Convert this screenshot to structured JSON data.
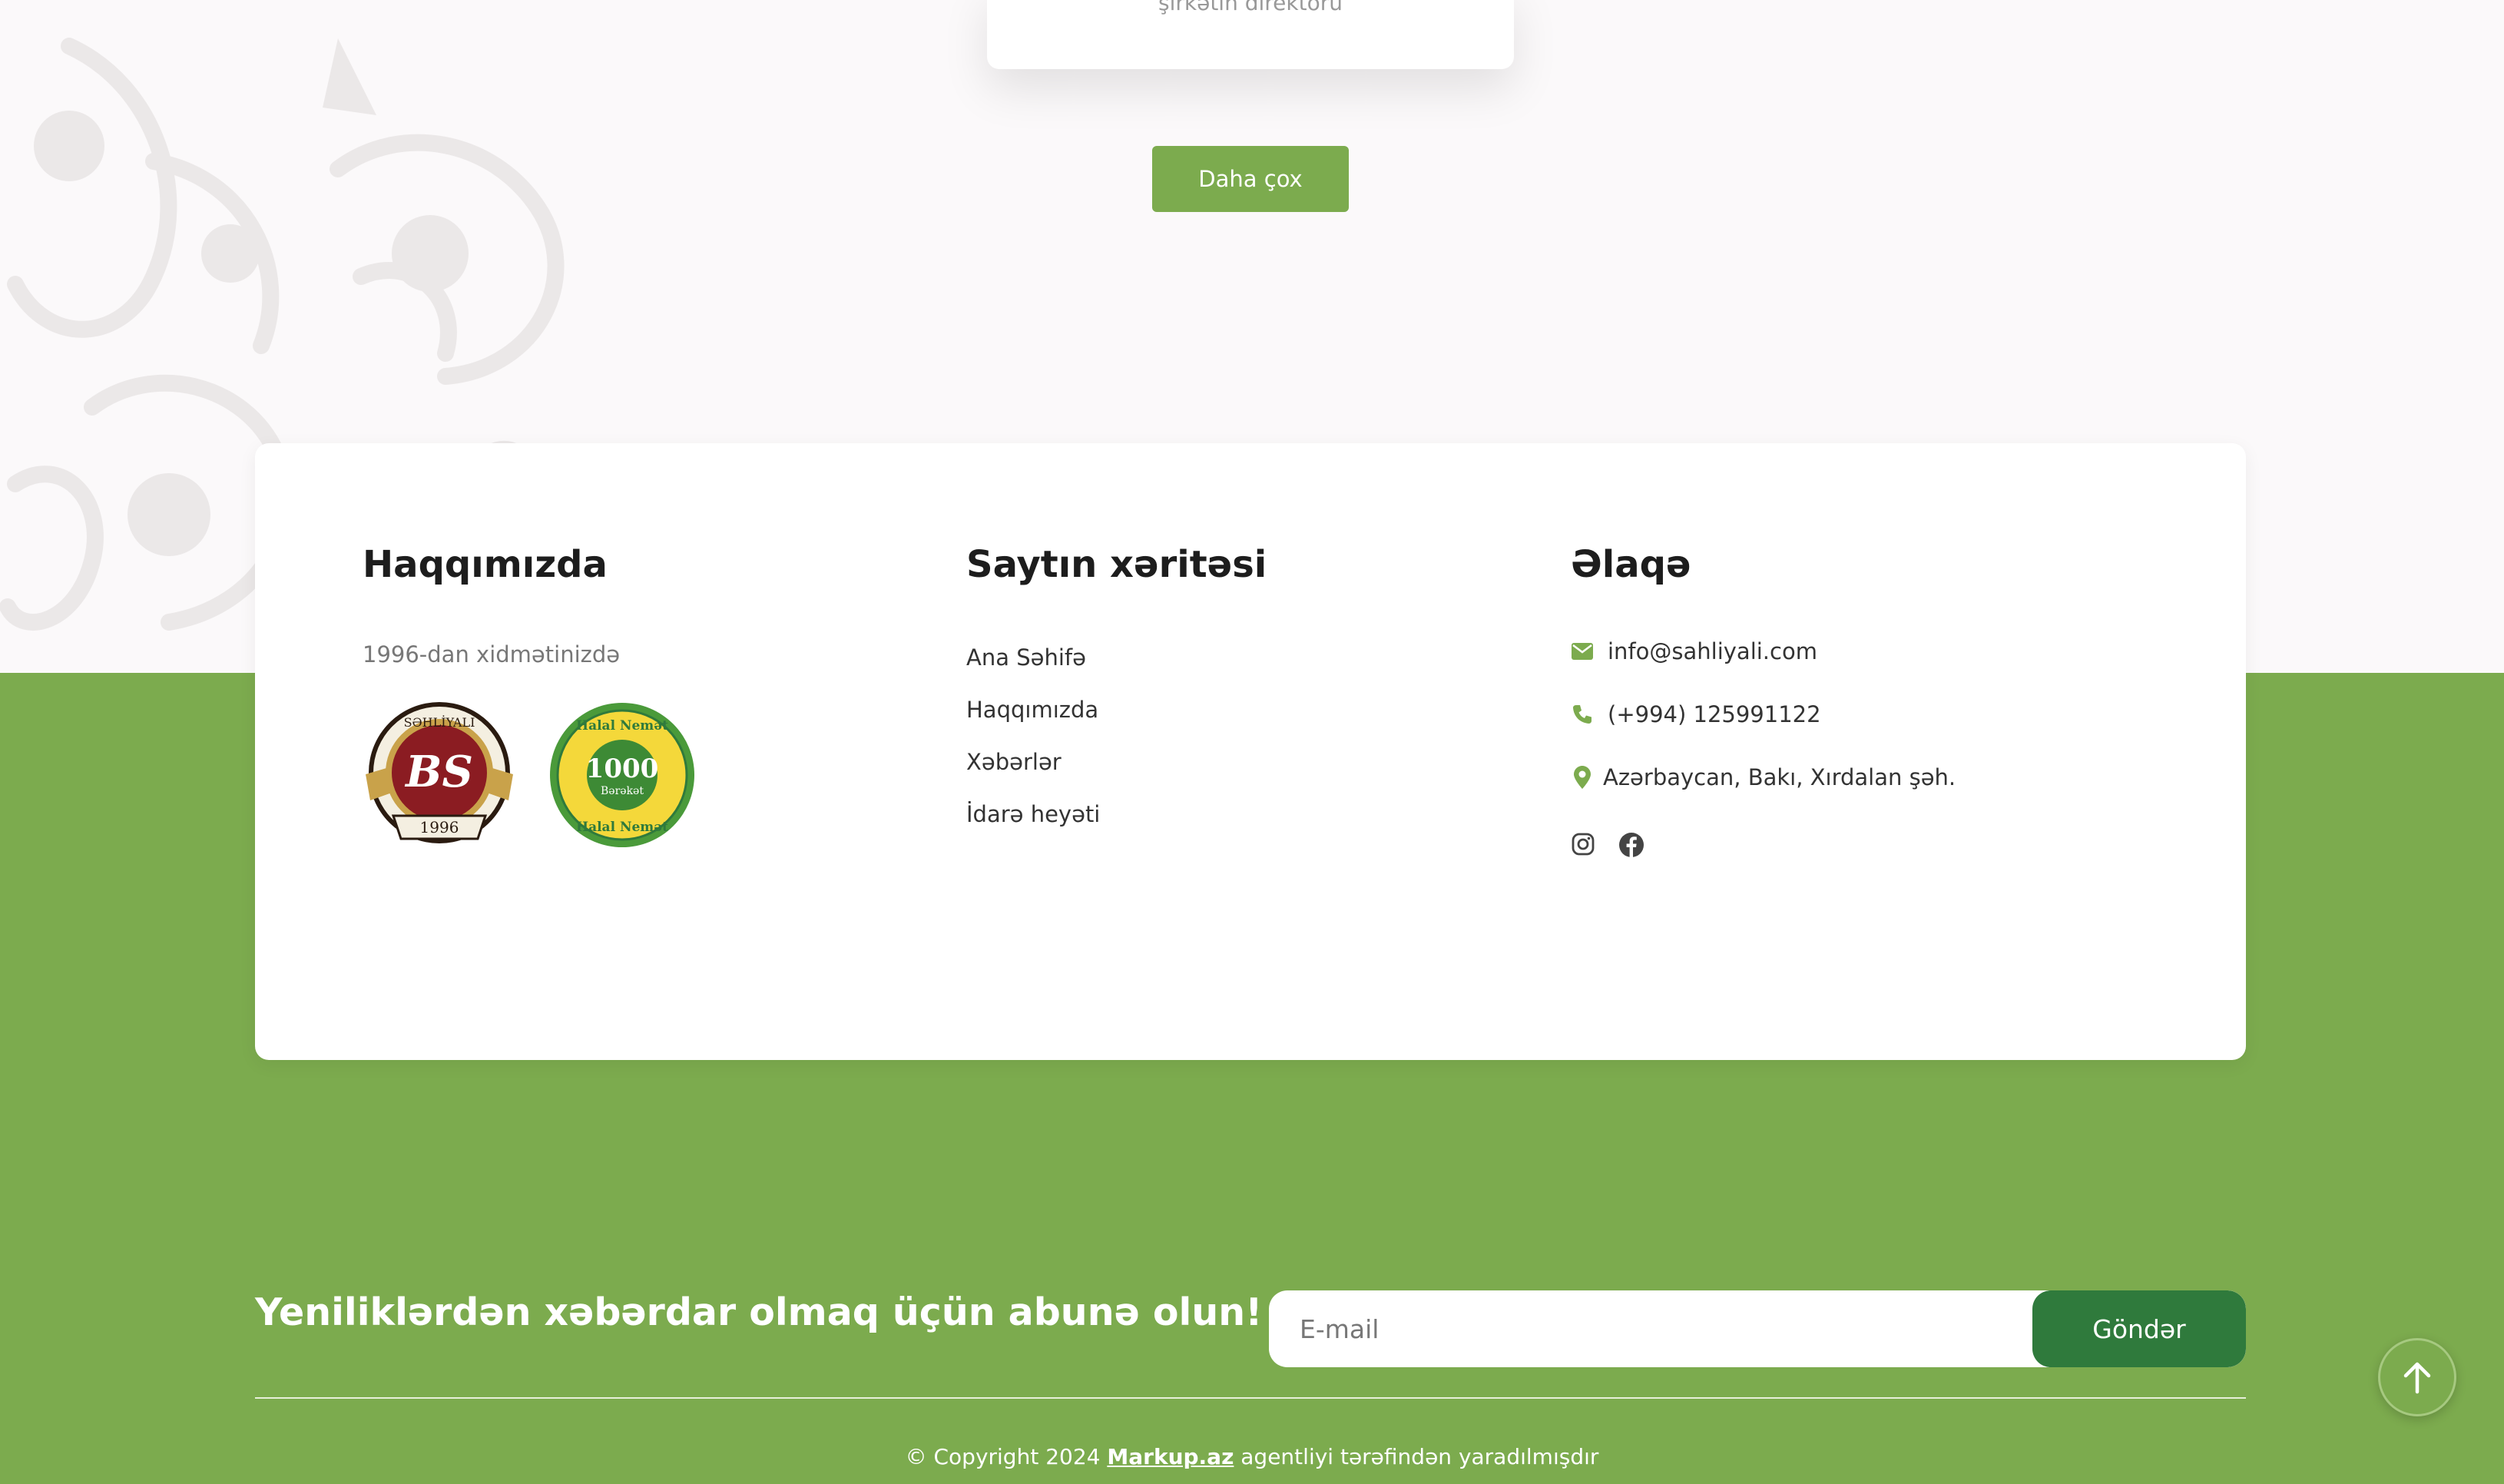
{
  "featured_card": {
    "clipped_text": "şirkətin direktoru"
  },
  "more_button": {
    "label": "Daha çox"
  },
  "footer": {
    "about": {
      "title": "Haqqımızda",
      "text": "1996-dan xidmətinizdə",
      "logos": [
        {
          "name": "sahliyali-logo",
          "text_top": "SƏHLİYALI",
          "monogram": "BS",
          "year": "1996"
        },
        {
          "name": "halal-nemat-logo",
          "text_top": "Halal Nemət",
          "center": "1000",
          "center_sub": "Bərəkət",
          "text_bottom": "Halal Nemət"
        }
      ]
    },
    "sitemap": {
      "title": "Saytın xəritəsi",
      "links": [
        "Ana Səhifə",
        "Haqqımızda",
        "Xəbərlər",
        "İdarə heyəti"
      ]
    },
    "contact": {
      "title": "Əlaqə",
      "email": "info@sahliyali.com",
      "phone": "(+994) 125991122",
      "address": "Azərbaycan, Bakı, Xırdalan şəh.",
      "socials": [
        "instagram-icon",
        "facebook-icon"
      ]
    }
  },
  "subscribe": {
    "title": "Yeniliklərdən xəbərdar olmaq üçün abunə olun!",
    "placeholder": "E-mail",
    "button": "Göndər"
  },
  "copyright": {
    "prefix": "© Copyright 2024 ",
    "agency": "Markup.az",
    "suffix": " agentliyi tərəfindən yaradılmışdır"
  },
  "colors": {
    "brand_green": "#7cab4e",
    "dark_green": "#2f7a3c",
    "logo_red": "#8b1c22",
    "logo_gold": "#c9a24a"
  }
}
